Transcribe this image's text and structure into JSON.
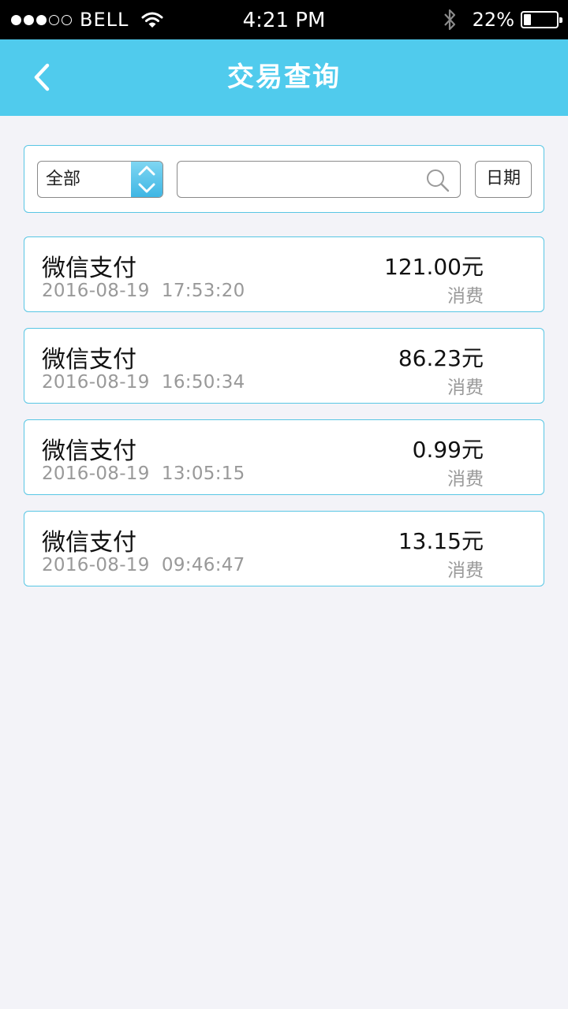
{
  "status_bar": {
    "carrier": "BELL",
    "time": "4:21 PM",
    "battery_percent": "22%",
    "battery_level": 0.22,
    "signal_strength": 3,
    "signal_max": 5,
    "icons": [
      "signal-icon",
      "wifi-icon",
      "bluetooth-icon",
      "battery-icon"
    ]
  },
  "nav": {
    "title": "交易查询",
    "back_icon": "chevron-left-icon"
  },
  "filter": {
    "type_selected": "全部",
    "search_value": "",
    "search_icon": "search-icon",
    "date_button": "日期"
  },
  "transactions": [
    {
      "name": "微信支付",
      "date": "2016-08-19",
      "time": "17:53:20",
      "amount": "121.00元",
      "type": "消费"
    },
    {
      "name": "微信支付",
      "date": "2016-08-19",
      "time": "16:50:34",
      "amount": "86.23元",
      "type": "消费"
    },
    {
      "name": "微信支付",
      "date": "2016-08-19",
      "time": "13:05:15",
      "amount": "0.99元",
      "type": "消费"
    },
    {
      "name": "微信支付",
      "date": "2016-08-19",
      "time": "09:46:47",
      "amount": "13.15元",
      "type": "消费"
    }
  ],
  "colors": {
    "accent": "#50cbed",
    "card_border": "#58c6e4",
    "background": "#f3f3f8",
    "muted_text": "#999999"
  }
}
